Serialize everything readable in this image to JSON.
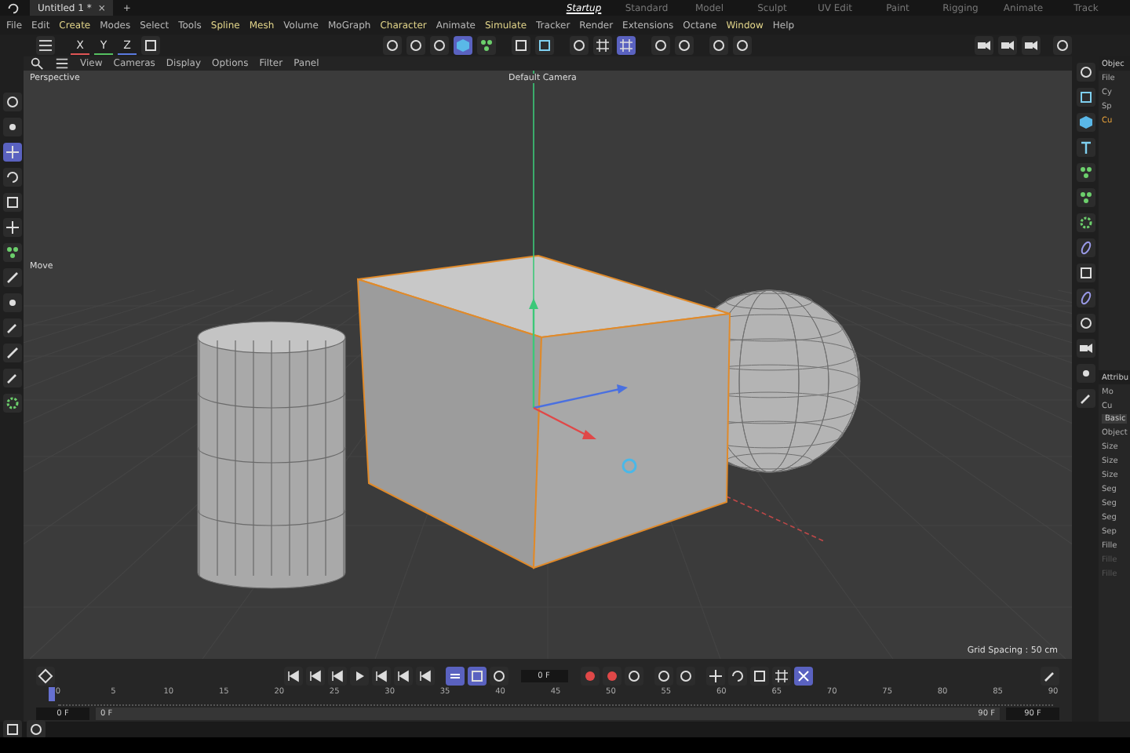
{
  "title_bar": {
    "documents": [
      {
        "label": "Untitled 1 *",
        "selected": true
      }
    ],
    "close": "×",
    "new_tab": "+",
    "layouts": [
      {
        "label": "Startup",
        "selected": true
      },
      {
        "label": "Standard",
        "selected": false
      },
      {
        "label": "Model",
        "selected": false
      },
      {
        "label": "Sculpt",
        "selected": false
      },
      {
        "label": "UV Edit",
        "selected": false
      },
      {
        "label": "Paint",
        "selected": false
      },
      {
        "label": "Rigging",
        "selected": false
      },
      {
        "label": "Animate",
        "selected": false
      },
      {
        "label": "Track",
        "selected": false
      }
    ]
  },
  "menu": [
    {
      "label": "File",
      "highlighted": false
    },
    {
      "label": "Edit",
      "highlighted": false
    },
    {
      "label": "Create",
      "highlighted": true
    },
    {
      "label": "Modes",
      "highlighted": false
    },
    {
      "label": "Select",
      "highlighted": false
    },
    {
      "label": "Tools",
      "highlighted": false
    },
    {
      "label": "Spline",
      "highlighted": true
    },
    {
      "label": "Mesh",
      "highlighted": true
    },
    {
      "label": "Volume",
      "highlighted": false
    },
    {
      "label": "MoGraph",
      "highlighted": false
    },
    {
      "label": "Character",
      "highlighted": true
    },
    {
      "label": "Animate",
      "highlighted": false
    },
    {
      "label": "Simulate",
      "highlighted": true
    },
    {
      "label": "Tracker",
      "highlighted": false
    },
    {
      "label": "Render",
      "highlighted": false
    },
    {
      "label": "Extensions",
      "highlighted": false
    },
    {
      "label": "Octane",
      "highlighted": false
    },
    {
      "label": "Window",
      "highlighted": true
    },
    {
      "label": "Help",
      "highlighted": false
    }
  ],
  "axis_locks": [
    {
      "label": "X",
      "color": "#e05555"
    },
    {
      "label": "Y",
      "color": "#55c060"
    },
    {
      "label": "Z",
      "color": "#5a7ae0"
    }
  ],
  "toolbar_modes": [
    {
      "selected": false
    },
    {
      "selected": false
    },
    {
      "selected": false
    },
    {
      "selected": true
    },
    {
      "selected": false
    }
  ],
  "toolbar_snap": [
    {
      "selected": false
    },
    {
      "selected": true
    }
  ],
  "left_tools": [
    {
      "selected": false
    },
    {
      "selected": false
    },
    {
      "selected": true
    },
    {
      "selected": false
    },
    {
      "selected": false
    },
    {
      "selected": false
    },
    {
      "selected": false
    },
    {
      "selected": false
    },
    {
      "selected": false
    },
    {
      "selected": false
    },
    {
      "selected": false
    },
    {
      "selected": false
    },
    {
      "selected": false
    }
  ],
  "viewport": {
    "menu": [
      "View",
      "Cameras",
      "Display",
      "Options",
      "Filter",
      "Panel"
    ],
    "camera_mode": "Perspective",
    "camera": "Default Camera",
    "hud_label": "Move",
    "grid_spacing": "Grid Spacing : 50 cm"
  },
  "objects_panel": {
    "title": "Objec",
    "menu": "File",
    "items": [
      {
        "label": "Cy",
        "selected": false
      },
      {
        "label": "Sp",
        "selected": false
      },
      {
        "label": "Cu",
        "selected": true
      }
    ]
  },
  "attributes_panel": {
    "title": "Attribu",
    "mode": "Mo",
    "object": "Cu",
    "tab": "Basic",
    "section": "Object",
    "fields": [
      {
        "label": "Size",
        "disabled": false
      },
      {
        "label": "Size",
        "disabled": false
      },
      {
        "label": "Size",
        "disabled": false
      },
      {
        "label": "Seg",
        "disabled": false
      },
      {
        "label": "Seg",
        "disabled": false
      },
      {
        "label": "Seg",
        "disabled": false
      },
      {
        "label": "Sep",
        "disabled": false
      },
      {
        "label": "Fille",
        "disabled": false
      },
      {
        "label": "Fille",
        "disabled": true
      },
      {
        "label": "Fille",
        "disabled": true
      }
    ]
  },
  "timeline": {
    "current_frame": "0 F",
    "loop_on": true,
    "ticks": [
      "0",
      "5",
      "10",
      "15",
      "20",
      "25",
      "30",
      "35",
      "40",
      "45",
      "50",
      "55",
      "60",
      "65",
      "70",
      "75",
      "80",
      "85",
      "90"
    ],
    "start": "0 F",
    "range": {
      "level": 1,
      "start": "0 F",
      "end": "90 F"
    },
    "end": "90 F"
  }
}
